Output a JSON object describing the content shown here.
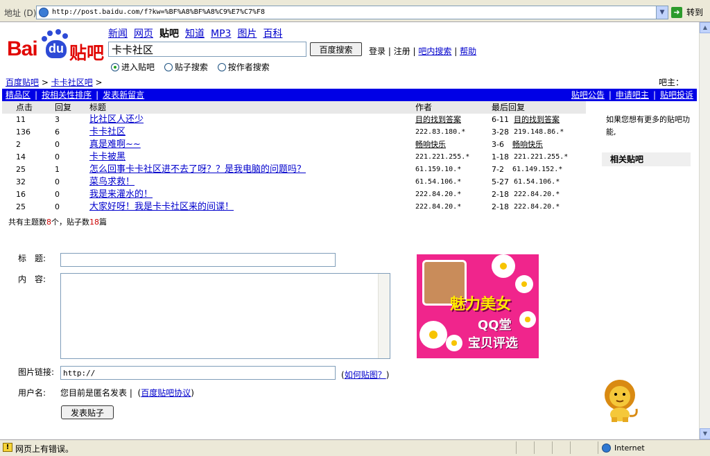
{
  "browser": {
    "address_label": "地址 (D)",
    "url": "http://post.baidu.com/f?kw=%BF%A8%BF%A8%C9%E7%C7%F8",
    "go_label": "转到",
    "status_text": "网页上有错误。",
    "zone_text": "Internet"
  },
  "header": {
    "logo_bai": "Bai",
    "logo_du": "du",
    "logo_tieba": "贴吧",
    "nav": [
      "新闻",
      "网页",
      "贴吧",
      "知道",
      "MP3",
      "图片",
      "百科"
    ],
    "search_value": "卡卡社区",
    "search_button": "百度搜索",
    "login": "登录",
    "register": "注册",
    "bar_search": "吧内搜索",
    "help": "帮助",
    "radios": [
      "进入贴吧",
      "贴子搜索",
      "按作者搜索"
    ]
  },
  "breadcrumb": {
    "home": "百度贴吧",
    "current": "卡卡社区吧",
    "bazhu": "吧主："
  },
  "bluebar": {
    "left": [
      "精品区",
      "按相关性排序",
      "发表新留言"
    ],
    "right": [
      "贴吧公告",
      "申请吧主",
      "贴吧投诉"
    ]
  },
  "thread_table": {
    "headers": [
      "点击",
      "回复",
      "标题",
      "作者",
      "最后回复"
    ],
    "rows": [
      {
        "clicks": "11",
        "replies": "3",
        "title": "比社区人还少",
        "author": "目的找到答案",
        "date": "6-11",
        "last": "目的找到答案"
      },
      {
        "clicks": "136",
        "replies": "6",
        "title": "卡卡社区",
        "author": "222.83.180.*",
        "date": "3-28",
        "last": "219.148.86.*"
      },
      {
        "clicks": "2",
        "replies": "0",
        "title": "真是难啊~~",
        "author": "畅响快乐",
        "date": "3-6",
        "last": "畅响快乐"
      },
      {
        "clicks": "14",
        "replies": "0",
        "title": "卡卡被黑",
        "author": "221.221.255.*",
        "date": "1-18",
        "last": "221.221.255.*"
      },
      {
        "clicks": "25",
        "replies": "1",
        "title": "怎么回事卡卡社区进不去了呀？？是我电脑的问题吗？",
        "author": "61.159.10.*",
        "date": "7-2",
        "last": "61.149.152.*"
      },
      {
        "clicks": "32",
        "replies": "0",
        "title": "菜鸟求救！",
        "author": "61.54.106.*",
        "date": "5-27",
        "last": "61.54.106.*"
      },
      {
        "clicks": "16",
        "replies": "0",
        "title": "我是来灌水的！",
        "author": "222.84.20.*",
        "date": "2-18",
        "last": "222.84.20.*"
      },
      {
        "clicks": "25",
        "replies": "0",
        "title": "大家好呀！我是卡卡社区来的间谍！",
        "author": "222.84.20.*",
        "date": "2-18",
        "last": "222.84.20.*"
      }
    ],
    "summary_prefix": "共有主题数",
    "topic_count": "8",
    "summary_mid": "个，贴子数",
    "post_count": "18",
    "summary_suffix": "篇"
  },
  "sidebar": {
    "note": "如果您想有更多的贴吧功能,",
    "related_title": "相关贴吧"
  },
  "post_form": {
    "title_label": "标　题:",
    "content_label": "内　容:",
    "image_label": "图片链接:",
    "image_value": "http://",
    "how_image": "如何贴图？",
    "username_label": "用户名:",
    "anon_text": "您目前是匿名发表",
    "agreement": "百度贴吧协议",
    "submit": "发表贴子"
  },
  "ad": {
    "line1": "魅力美女",
    "line2": "QQ堂",
    "line3": "宝贝评选"
  }
}
